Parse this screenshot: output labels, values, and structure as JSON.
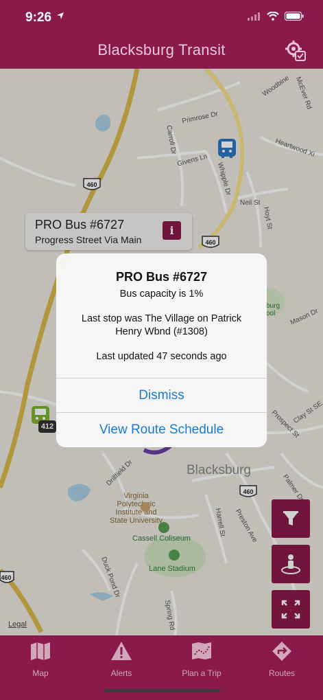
{
  "status": {
    "time": "9:26"
  },
  "header": {
    "title": "Blacksburg Transit"
  },
  "map": {
    "town_label": "Blacksburg",
    "streets": [
      "Woodbine",
      "McEver Rd",
      "Primrose Dr",
      "Heartwood Xi",
      "Carroll Dr",
      "Givens Ln",
      "Whipple Dr",
      "Neil St",
      "Hoyt St",
      "Mason Dr",
      "Clay St SE",
      "Prospect St",
      "Palmer Dr",
      "Harrell St",
      "Preston Ave",
      "Drillfield Dr",
      "Duck Pond Dr",
      "Spring Rd"
    ],
    "poi": {
      "vt": "Virginia Polytechnic Institute and State University",
      "vt_lines": [
        "Virginia",
        "Polytechnic",
        "Institute and",
        "State University"
      ],
      "coliseum": "Cassell Coliseum",
      "stadium": "Lane Stadium",
      "school_lines": [
        "burg",
        "ool"
      ]
    },
    "route_shields": [
      "460",
      "460",
      "460",
      "460"
    ],
    "bus_number_badge": "412",
    "legal": "Legal"
  },
  "callout": {
    "title": "PRO Bus #6727",
    "subtitle": "Progress Street Via Main",
    "info_glyph": "i"
  },
  "alert": {
    "title": "PRO Bus #6727",
    "capacity": "Bus capacity is 1%",
    "last_stop_line1": "Last stop was The Village on Patrick",
    "last_stop_line2": "Henry Wbnd (#1308)",
    "updated": "Last updated 47 seconds ago",
    "dismiss_label": "Dismiss",
    "schedule_label": "View Route Schedule"
  },
  "tabs": [
    {
      "label": "Map",
      "icon": "map-icon"
    },
    {
      "label": "Alerts",
      "icon": "alert-icon"
    },
    {
      "label": "Plan a Trip",
      "icon": "plan-trip-icon"
    },
    {
      "label": "Routes",
      "icon": "routes-icon"
    }
  ],
  "colors": {
    "brand": "#8a1a4b",
    "link": "#1a7ad0",
    "bus_blue": "#2a78c4",
    "bus_green": "#7bb32e"
  }
}
